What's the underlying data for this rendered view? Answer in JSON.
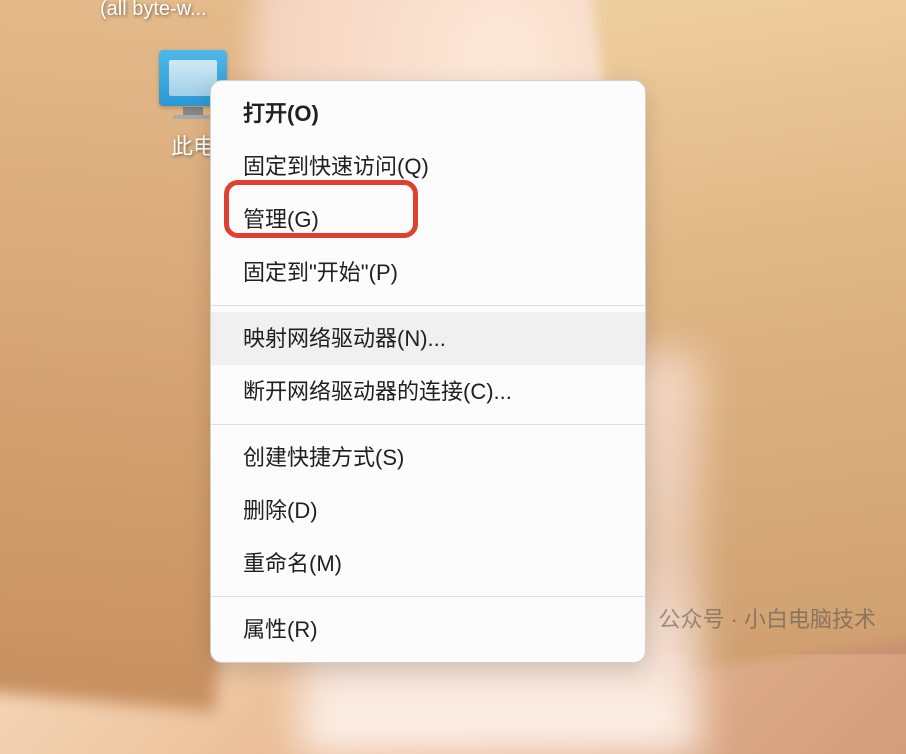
{
  "desktop": {
    "truncated_label_top": "(all byte-w...",
    "icon_label": "此电"
  },
  "menu": {
    "items": {
      "open": "打开(O)",
      "pin_quick_access": "固定到快速访问(Q)",
      "manage": "管理(G)",
      "pin_start": "固定到\"开始\"(P)",
      "map_network": "映射网络驱动器(N)...",
      "disconnect_network": "断开网络驱动器的连接(C)...",
      "create_shortcut": "创建快捷方式(S)",
      "delete": "删除(D)",
      "rename": "重命名(M)",
      "properties": "属性(R)"
    }
  },
  "watermark": {
    "text": "公众号 · 小白电脑技术"
  }
}
